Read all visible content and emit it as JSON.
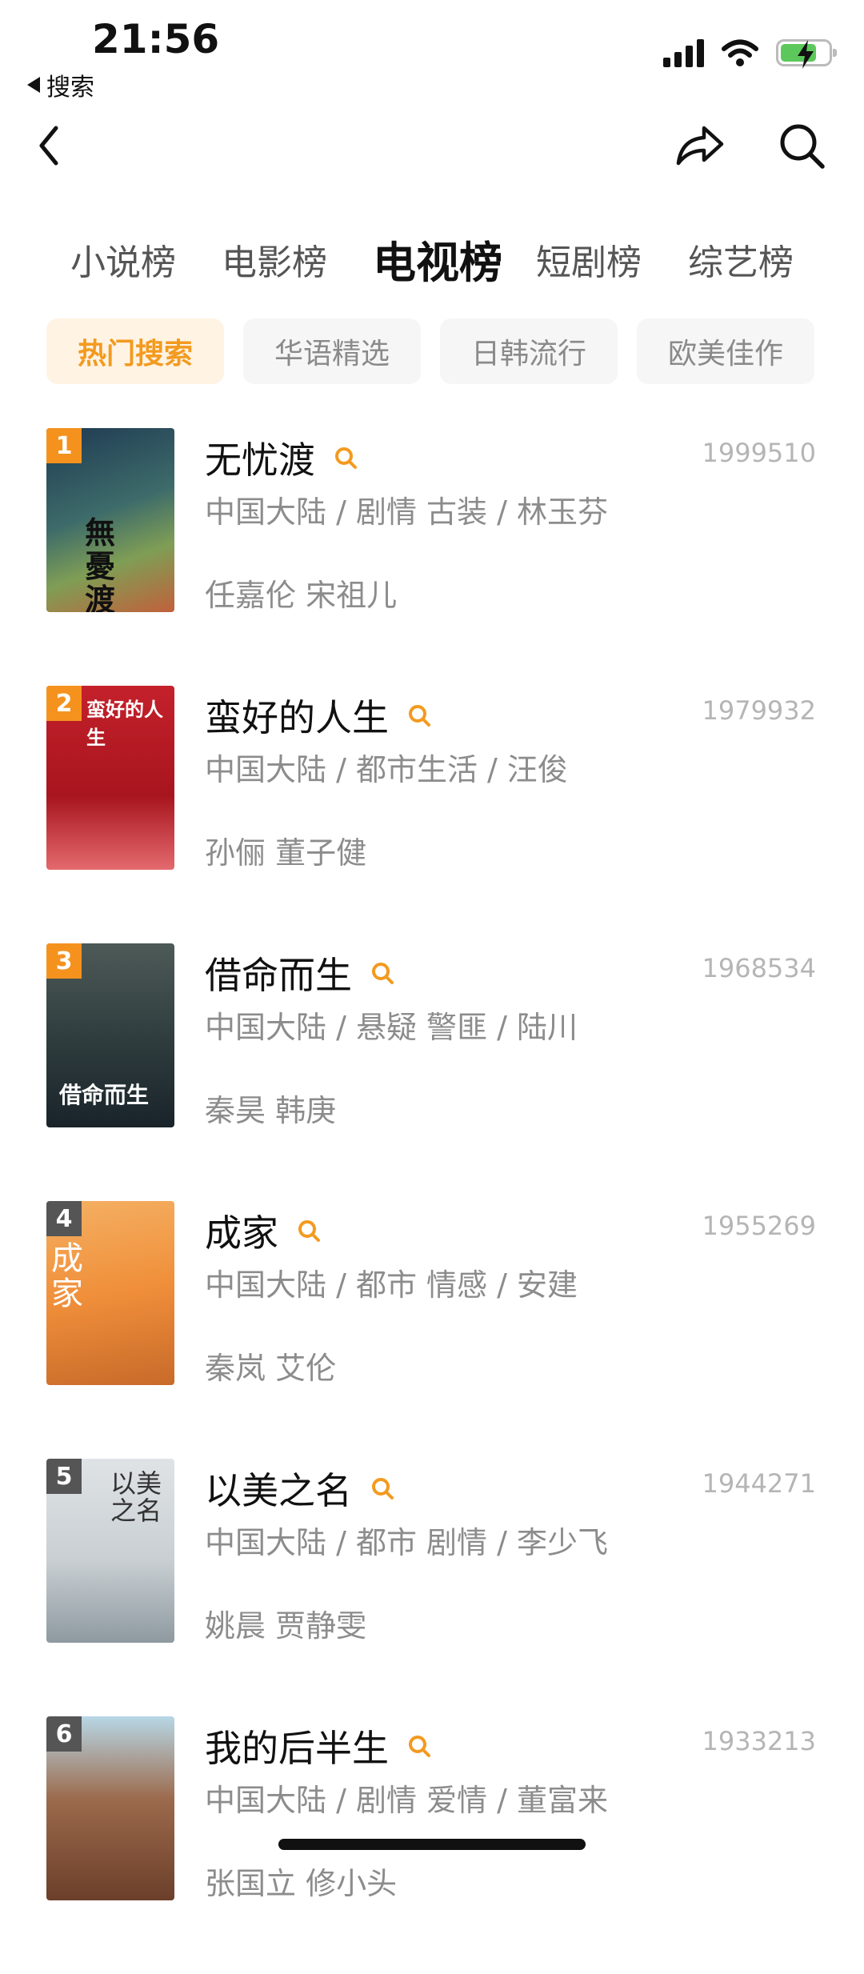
{
  "status_bar": {
    "time": "21:56",
    "back_app": "搜索"
  },
  "header": {
    "back_icon": "chevron-left-icon",
    "share_icon": "share-icon",
    "search_icon": "search-icon"
  },
  "category_tabs": [
    {
      "label": "小说榜"
    },
    {
      "label": "电影榜"
    },
    {
      "label": "电视榜",
      "active": true
    },
    {
      "label": "短剧榜"
    },
    {
      "label": "综艺榜"
    }
  ],
  "sub_tabs": [
    {
      "label": "热门搜索",
      "active": true
    },
    {
      "label": "华语精选"
    },
    {
      "label": "日韩流行"
    },
    {
      "label": "欧美佳作"
    }
  ],
  "rank_colors": {
    "top3": "#f5921e",
    "rest": "#555555"
  },
  "accent_color": "#f39a1f",
  "items": [
    {
      "rank": "1",
      "title": "无忧渡",
      "count": "1999510",
      "meta": "中国大陆 / 剧情 古装 / 林玉芬",
      "actors": "任嘉伦 宋祖儿",
      "poster_text": "無憂渡"
    },
    {
      "rank": "2",
      "title": "蛮好的人生",
      "count": "1979932",
      "meta": "中国大陆 / 都市生活 / 汪俊",
      "actors": "孙俪 董子健",
      "poster_text": "蛮好的人生"
    },
    {
      "rank": "3",
      "title": "借命而生",
      "count": "1968534",
      "meta": "中国大陆 / 悬疑 警匪 / 陆川",
      "actors": "秦昊 韩庚",
      "poster_text": "借命而生"
    },
    {
      "rank": "4",
      "title": "成家",
      "count": "1955269",
      "meta": "中国大陆 / 都市 情感 / 安建",
      "actors": "秦岚 艾伦",
      "poster_text": "成家"
    },
    {
      "rank": "5",
      "title": "以美之名",
      "count": "1944271",
      "meta": "中国大陆 / 都市 剧情 / 李少飞",
      "actors": "姚晨 贾静雯",
      "poster_text": "以美之名"
    },
    {
      "rank": "6",
      "title": "我的后半生",
      "count": "1933213",
      "meta": "中国大陆 / 剧情 爱情 / 董富来",
      "actors": "张国立 修小头",
      "poster_text": ""
    }
  ]
}
